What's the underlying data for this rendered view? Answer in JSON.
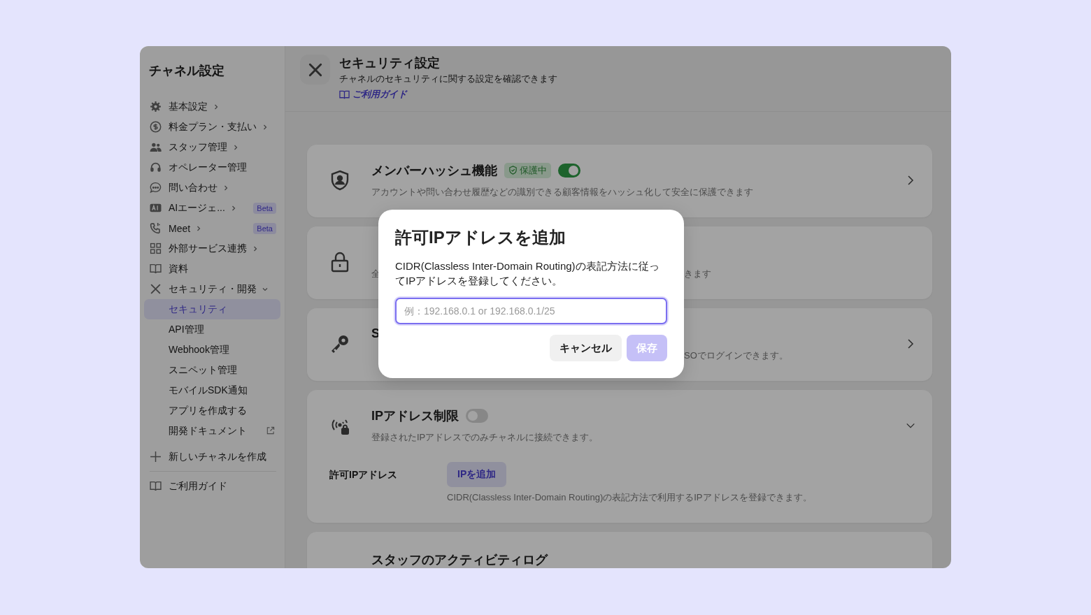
{
  "sidebar": {
    "title": "チャネル設定",
    "items": [
      {
        "label": "基本設定",
        "kind": "menu"
      },
      {
        "label": "料金プラン・支払い",
        "kind": "menu"
      },
      {
        "label": "スタッフ管理",
        "kind": "menu"
      },
      {
        "label": "オペレーター管理",
        "kind": "link"
      },
      {
        "label": "問い合わせ",
        "kind": "menu"
      },
      {
        "label": "AIエージェ...",
        "kind": "menu",
        "badge": "Beta"
      },
      {
        "label": "Meet",
        "kind": "menu",
        "badge": "Beta"
      },
      {
        "label": "外部サービス連携",
        "kind": "menu"
      },
      {
        "label": "資料",
        "kind": "link"
      },
      {
        "label": "セキュリティ・開発",
        "kind": "group",
        "expanded": true,
        "children": [
          {
            "label": "セキュリティ",
            "selected": true,
            "external": false
          },
          {
            "label": "API管理",
            "selected": false,
            "external": false
          },
          {
            "label": "Webhook管理",
            "selected": false,
            "external": false
          },
          {
            "label": "スニペット管理",
            "selected": false,
            "external": false
          },
          {
            "label": "モバイルSDK通知",
            "selected": false,
            "external": false
          },
          {
            "label": "アプリを作成する",
            "selected": false,
            "external": false
          },
          {
            "label": "開発ドキュメント",
            "selected": false,
            "external": true
          }
        ]
      }
    ],
    "create_item": {
      "label": "新しいチャネルを作成"
    },
    "guide_item": {
      "label": "ご利用ガイド"
    }
  },
  "header": {
    "title": "セキュリティ設定",
    "subtitle": "チャネルのセキュリティに関する設定を確認できます",
    "guide_link": "ご利用ガイド"
  },
  "cards": [
    {
      "kind": "link",
      "title": "メンバーハッシュ機能",
      "badge": "保護中",
      "toggle_on": true,
      "desc": "アカウントや問い合わせ履歴などの識別できる顧客情報をハッシュ化して安全に保護できます"
    },
    {
      "kind": "plain",
      "desc": "全",
      "desc_tail": "きます"
    },
    {
      "kind": "link",
      "title": "S",
      "desc_tail": "SOでログインできます。"
    },
    {
      "kind": "expandable",
      "expanded": true,
      "title": "IPアドレス制限",
      "toggle_on": false,
      "desc": "登録されたIPアドレスでのみチャネルに接続できます。",
      "field_label": "許可IPアドレス",
      "add_button": "IPを追加",
      "hint": "CIDR(Classless Inter-Domain Routing)の表記方法で利用するIPアドレスを登録できます。"
    },
    {
      "kind": "plain",
      "title": "スタッフのアクティビティログ"
    }
  ],
  "dialog": {
    "title": "許可IPアドレスを追加",
    "body": "CIDR(Classless Inter-Domain Routing)の表記方法に従ってIPアドレスを登録してください。",
    "placeholder": "例：192.168.0.1 or 192.168.0.1/25",
    "cancel": "キャンセル",
    "save": "保存",
    "save_disabled": true
  }
}
